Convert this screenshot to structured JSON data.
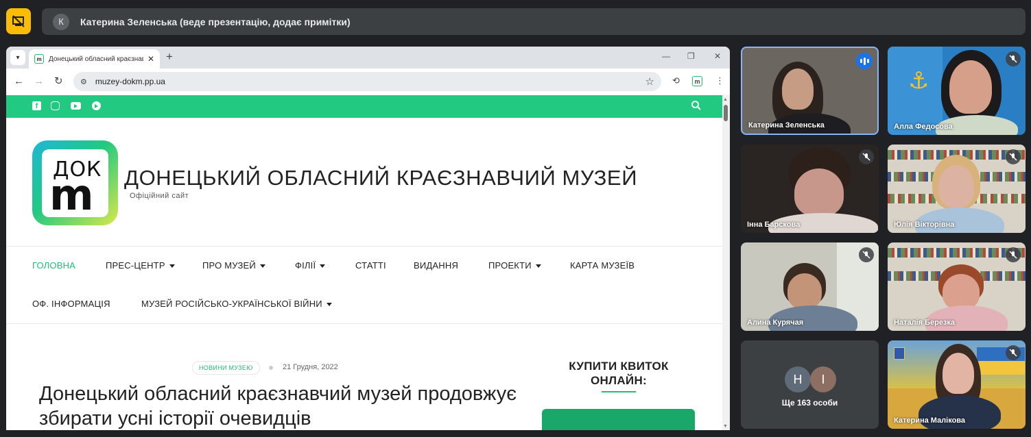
{
  "presenter": {
    "avatar_letter": "К",
    "label": "Катерина Зеленська (веде презентацію, додає примітки)"
  },
  "browser": {
    "tab_title": "Донецький обласний краєзнавчий музей",
    "tab_close": "✕",
    "new_tab": "+",
    "url": "muzey-dokm.pp.ua",
    "win_min": "—",
    "win_restore": "❐",
    "win_close": "✕"
  },
  "site": {
    "logo_top": "ДОК",
    "logo_letter": "m",
    "title": "ДОНЕЦЬКИЙ ОБЛАСНИЙ КРАЄЗНАВЧИЙ МУЗЕЙ",
    "subtitle": "Офіційний сайт",
    "menu": [
      {
        "label": "ГОЛОВНА",
        "active": true,
        "dropdown": false
      },
      {
        "label": "ПРЕС-ЦЕНТР",
        "active": false,
        "dropdown": true
      },
      {
        "label": "ПРО МУЗЕЙ",
        "active": false,
        "dropdown": true
      },
      {
        "label": "ФІЛІЇ",
        "active": false,
        "dropdown": true
      },
      {
        "label": "СТАТТІ",
        "active": false,
        "dropdown": false
      },
      {
        "label": "ВИДАННЯ",
        "active": false,
        "dropdown": false
      },
      {
        "label": "ПРОЕКТИ",
        "active": false,
        "dropdown": true
      },
      {
        "label": "КАРТА МУЗЕЇВ",
        "active": false,
        "dropdown": false
      },
      {
        "label": "ОФ. ІНФОРМАЦІЯ",
        "active": false,
        "dropdown": false
      },
      {
        "label": "МУЗЕЙ РОСІЙСЬКО-УКРАЇНСЬКОЇ ВІЙНИ",
        "active": false,
        "dropdown": true
      }
    ],
    "post": {
      "category": "НОВИНИ МУЗЕЮ",
      "date": "21 Грудня, 2022",
      "title": "Донецький обласний краєзнавчий музей продовжує збирати усні історії очевидців"
    },
    "sidebar": {
      "buy_ticket": "КУПИТИ КВИТОК ОНЛАЙН:"
    }
  },
  "participants": [
    {
      "name": "Катерина Зеленська",
      "speaking": true,
      "muted": false
    },
    {
      "name": "Алла Федосова",
      "speaking": false,
      "muted": true
    },
    {
      "name": "Інна Барскова",
      "speaking": false,
      "muted": true
    },
    {
      "name": "Юлія Вікторівна",
      "speaking": false,
      "muted": true
    },
    {
      "name": "Алина Курячая",
      "speaking": false,
      "muted": true
    },
    {
      "name": "Наталія Березка",
      "speaking": false,
      "muted": true
    },
    {
      "name": "Катерина Малікова",
      "speaking": false,
      "muted": true
    }
  ],
  "more_participants": {
    "avatars": [
      "Н",
      "І"
    ],
    "label": "Ще 163 особи"
  },
  "colors": {
    "accent_green": "#22c980",
    "present_yellow": "#fbbc04",
    "speaking_blue": "#1a73e8"
  }
}
